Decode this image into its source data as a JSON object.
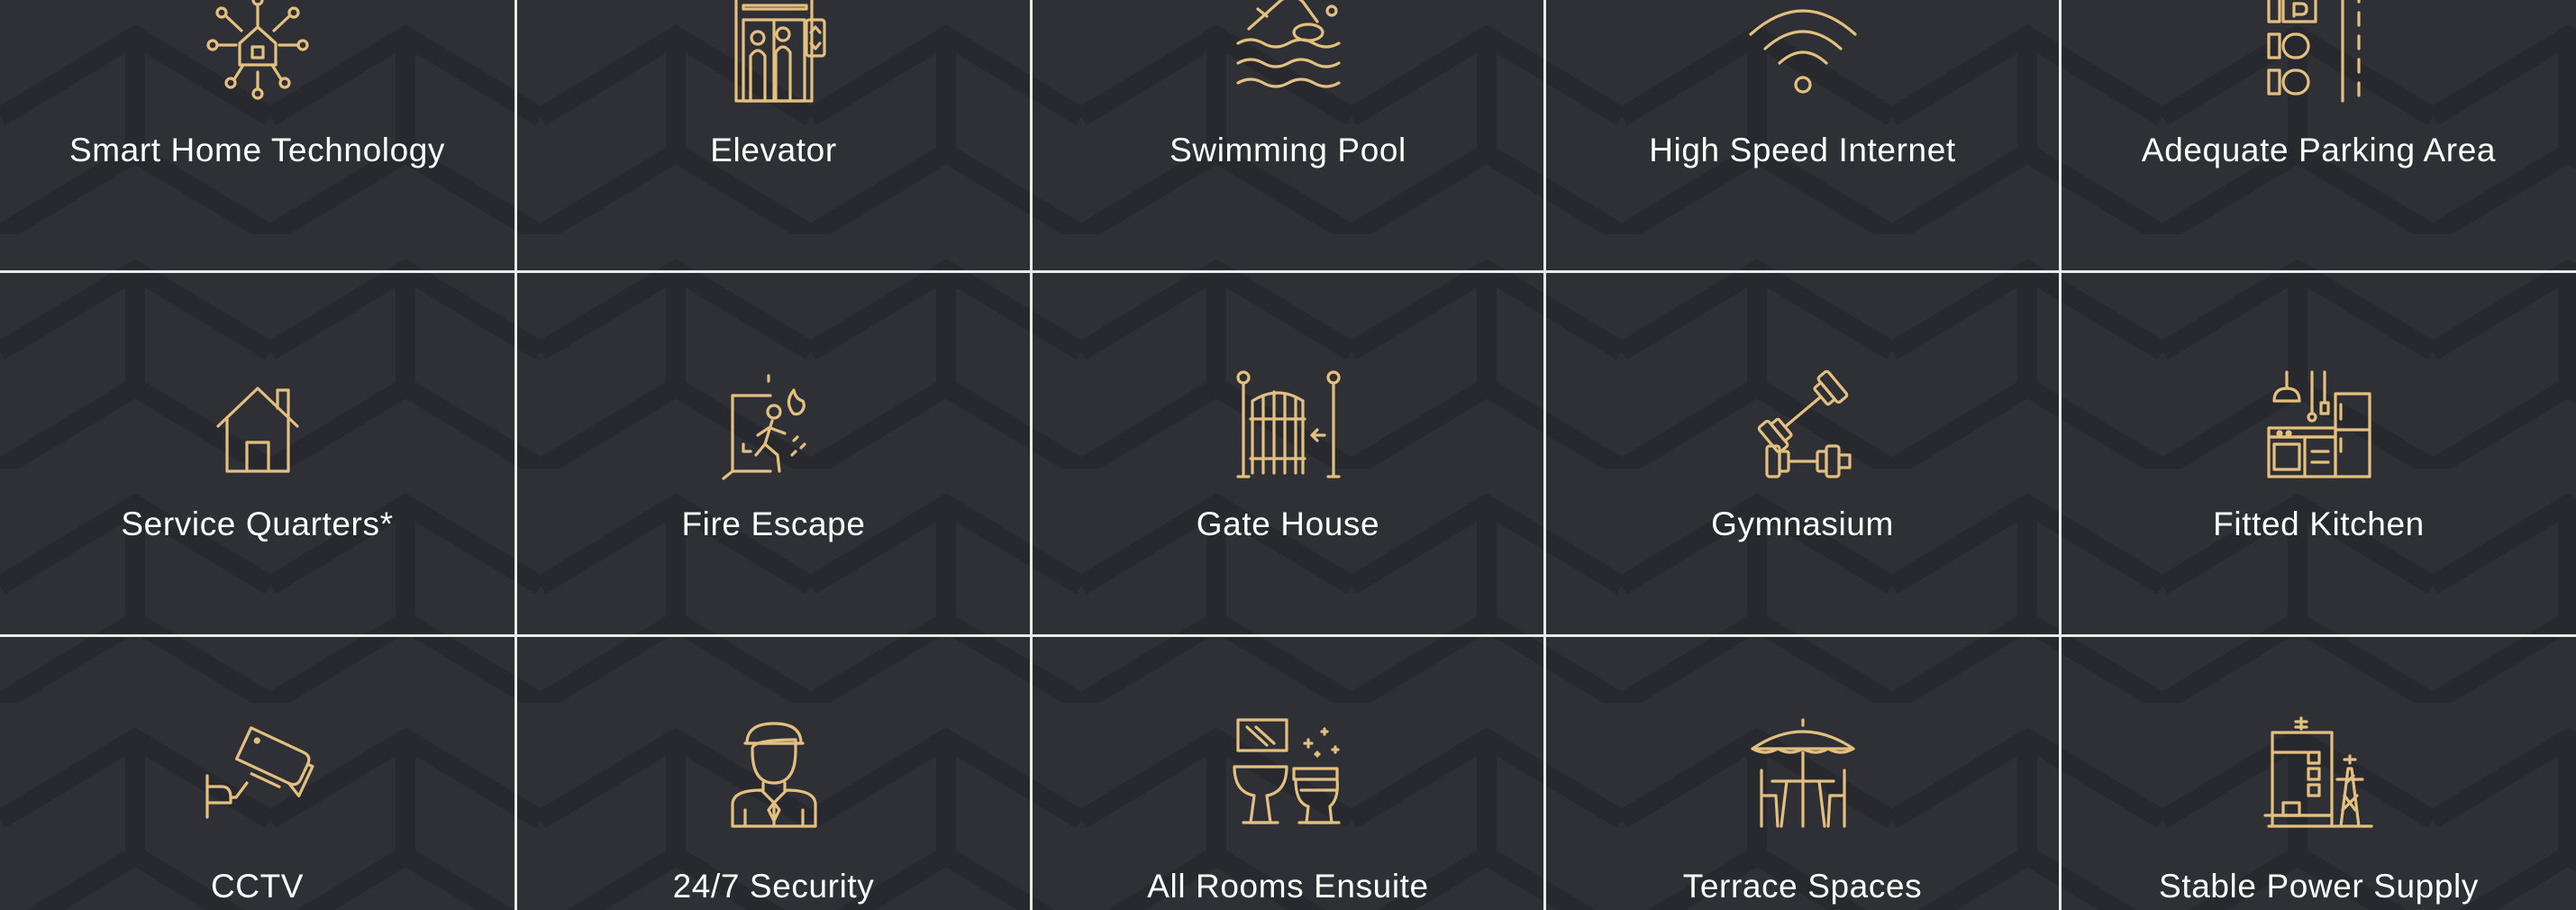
{
  "amenities": [
    {
      "label": "Smart Home Technology",
      "icon": "smart-home-icon"
    },
    {
      "label": "Elevator",
      "icon": "elevator-icon"
    },
    {
      "label": "Swimming Pool",
      "icon": "swimmer-icon"
    },
    {
      "label": "High Speed Internet",
      "icon": "wifi-icon"
    },
    {
      "label": "Adequate Parking Area",
      "icon": "parking-icon"
    },
    {
      "label": "Service Quarters*",
      "icon": "house-icon"
    },
    {
      "label": "Fire Escape",
      "icon": "fire-exit-icon"
    },
    {
      "label": "Gate House",
      "icon": "gate-icon"
    },
    {
      "label": "Gymnasium",
      "icon": "dumbbell-icon"
    },
    {
      "label": "Fitted Kitchen",
      "icon": "kitchen-icon"
    },
    {
      "label": "CCTV",
      "icon": "cctv-camera-icon"
    },
    {
      "label": "24/7 Security",
      "icon": "security-guard-icon"
    },
    {
      "label": "All Rooms Ensuite",
      "icon": "toilet-sink-icon"
    },
    {
      "label": "Terrace Spaces",
      "icon": "patio-umbrella-icon"
    },
    {
      "label": "Stable Power Supply",
      "icon": "power-plant-icon"
    }
  ],
  "colors": {
    "background": "#2f3035",
    "icon_gold": "#e3c07f",
    "divider": "#e9e9ea",
    "text": "#ffffff"
  }
}
